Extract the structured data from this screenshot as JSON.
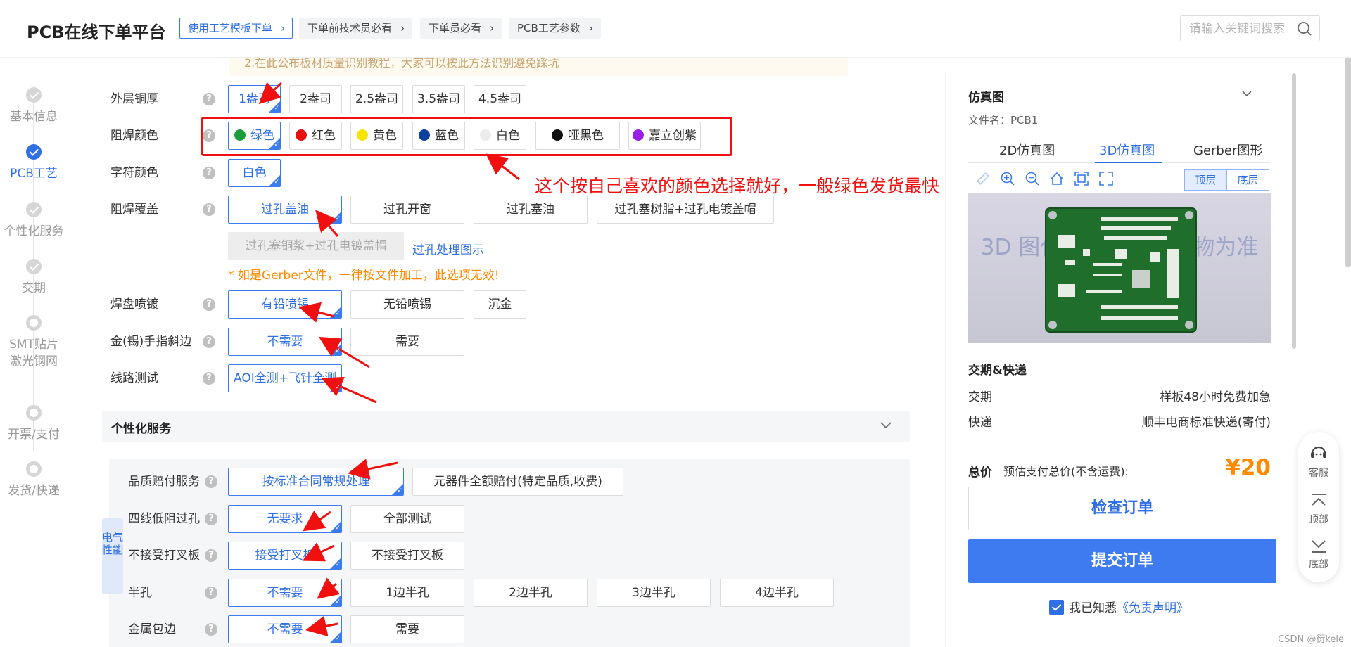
{
  "header": {
    "brand": "PCB在线下单平台",
    "nav": [
      "使用工艺模板下单",
      "下单前技术员必看",
      "下单员必看",
      "PCB工艺参数"
    ],
    "search_placeholder": "请输入关键词搜索"
  },
  "steps": [
    "基本信息",
    "PCB工艺",
    "个性化服务",
    "交期",
    "SMT贴片",
    "激光钢网",
    "开票/支付",
    "发货/快递"
  ],
  "notice": "2.在此公布板材质量识别教程，大家可以按此方法识别避免踩坑",
  "form": {
    "outer_copper": {
      "label": "外层铜厚",
      "options": [
        "1盎司",
        "2盎司",
        "2.5盎司",
        "3.5盎司",
        "4.5盎司"
      ]
    },
    "solder_mask_color": {
      "label": "阻焊颜色",
      "options": [
        "绿色",
        "红色",
        "黄色",
        "蓝色",
        "白色",
        "哑黑色",
        "嘉立创紫"
      ]
    },
    "silkscreen_color": {
      "label": "字符颜色",
      "options": [
        "白色"
      ]
    },
    "solder_mask_cover": {
      "label": "阻焊覆盖",
      "options": [
        "过孔盖油",
        "过孔开窗",
        "过孔塞油",
        "过孔塞树脂+过孔电镀盖帽",
        "过孔塞铜浆+过孔电镀盖帽"
      ],
      "link": "过孔处理图示",
      "warning": "* 如是Gerber文件，一律按文件加工，此选项无效!"
    },
    "pad_finish": {
      "label": "焊盘喷镀",
      "options": [
        "有铅喷锡",
        "无铅喷锡",
        "沉金"
      ]
    },
    "gold_finger": {
      "label": "金(锡)手指斜边",
      "options": [
        "不需要",
        "需要"
      ]
    },
    "circuit_test": {
      "label": "线路测试",
      "options": [
        "AOI全测+飞针全测"
      ]
    }
  },
  "annotation": "这个按自己喜欢的颜色选择就好，一般绿色发货最快",
  "personal": {
    "title": "个性化服务",
    "side_tag": "电气性能",
    "quality": {
      "label": "品质赔付服务",
      "options": [
        "按标准合同常规处理",
        "元器件全额赔付(特定品质,收费)"
      ]
    },
    "four_wire": {
      "label": "四线低阻过孔",
      "options": [
        "无要求",
        "全部测试"
      ]
    },
    "x_out": {
      "label": "不接受打叉板",
      "options": [
        "接受打叉板",
        "不接受打叉板"
      ]
    },
    "half_hole": {
      "label": "半孔",
      "options": [
        "不需要",
        "1边半孔",
        "2边半孔",
        "3边半孔",
        "4边半孔"
      ]
    },
    "metal_edge": {
      "label": "金属包边",
      "options": [
        "不需要",
        "需要"
      ]
    }
  },
  "panel": {
    "title": "仿真图",
    "filename": "文件名：PCB1",
    "tabs": [
      "2D仿真图",
      "3D仿真图",
      "Gerber图形"
    ],
    "layers": [
      "顶层",
      "底层"
    ],
    "watermark": "3D 图仅供参考，以实物为准",
    "delivery_title": "交期&快递",
    "delivery_label": "交期",
    "delivery_value": "样板48小时免费加急",
    "express_label": "快递",
    "express_value": "顺丰电商标准快递(寄付)",
    "total_label": "总价",
    "total_note": "预估支付总价(不含运费):",
    "price": "¥20",
    "check_btn": "检查订单",
    "submit_btn": "提交订单",
    "agree_text": "我已知悉",
    "agree_link": "《免责声明》"
  },
  "float": [
    "客服",
    "顶部",
    "底部"
  ],
  "watermark": "CSDN @衍kele",
  "colors": {
    "primary": "#2f6fe6",
    "annotation_red": "#f01010",
    "price_orange": "#ff8a00"
  }
}
